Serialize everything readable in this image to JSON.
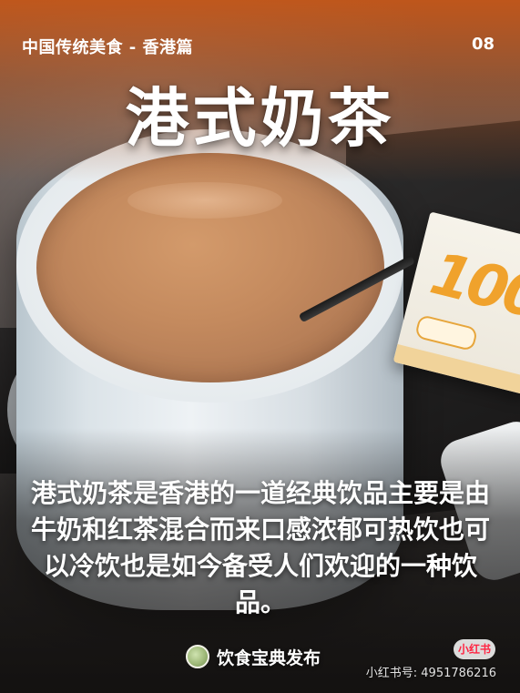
{
  "header": {
    "series": "中国传统美食 - 香港篇",
    "page_number": "08"
  },
  "title": "港式奶茶",
  "description": "港式奶茶是香港的一道经典饮品主要是由牛奶和红茶混合而来口感浓郁可热饮也可以冷饮也是如今备受人们欢迎的一种饮品。",
  "brand": {
    "name": "饮食宝典发布",
    "logo_icon": "food-logo-icon"
  },
  "watermark": {
    "badge": "小红书",
    "id_text": "小红书号: 4951786216"
  },
  "photo": {
    "sugar_packet_print": "100"
  },
  "colors": {
    "header_orange": "#c75a1a",
    "watermark_red": "#ff2442"
  }
}
